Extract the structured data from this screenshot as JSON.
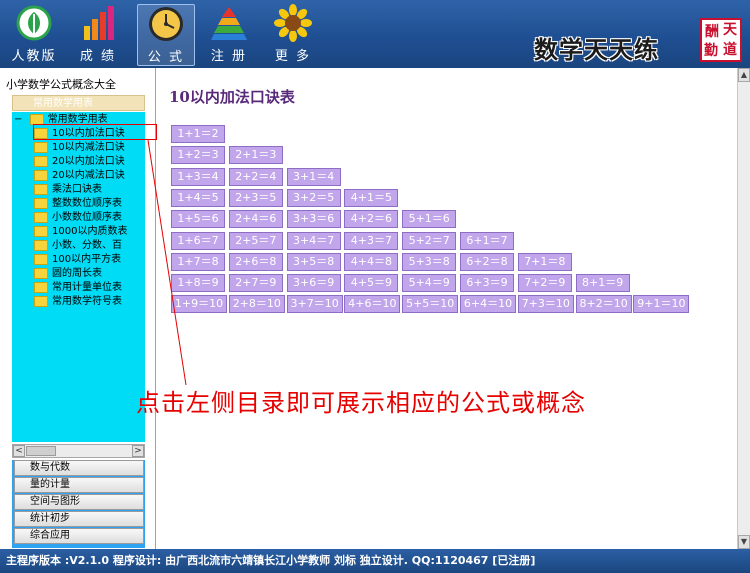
{
  "toolbar": {
    "buttons": [
      {
        "label": "人教版",
        "icon": "textbook-leaf-icon"
      },
      {
        "label": "成 绩",
        "icon": "bar-chart-icon"
      },
      {
        "label": "公 式",
        "icon": "clock-icon"
      },
      {
        "label": "注 册",
        "icon": "pyramid-icon"
      },
      {
        "label": "更 多",
        "icon": "sunflower-icon"
      }
    ],
    "logo_text": "数学天天练",
    "seal_chars": [
      "酬",
      "天",
      "勤",
      "道"
    ]
  },
  "sidebar": {
    "title": "小学数学公式概念大全",
    "active_item": "常用数学用表",
    "tree_root": "常用数学用表",
    "tree_items": [
      "10以内加法口诀",
      "10以内减法口诀",
      "20以内加法口诀",
      "20以内减法口诀",
      "乘法口诀表",
      "整数数位顺序表",
      "小数数位顺序表",
      "1000以内质数表",
      "小数、分数、百",
      "100以内平方表",
      "圆的周长表",
      "常用计量单位表",
      "常用数学符号表"
    ],
    "categories": [
      "数与代数",
      "量的计量",
      "空间与图形",
      "统计初步",
      "综合应用"
    ],
    "scroll_left": "<",
    "scroll_right": ">"
  },
  "main": {
    "title": "10以内加法口诀表",
    "table": [
      [
        "1+1＝2"
      ],
      [
        "1+2＝3",
        "2+1＝3"
      ],
      [
        "1+3＝4",
        "2+2＝4",
        "3+1＝4"
      ],
      [
        "1+4＝5",
        "2+3＝5",
        "3+2＝5",
        "4+1＝5"
      ],
      [
        "1+5＝6",
        "2+4＝6",
        "3+3＝6",
        "4+2＝6",
        "5+1＝6"
      ],
      [
        "1+6＝7",
        "2+5＝7",
        "3+4＝7",
        "4+3＝7",
        "5+2＝7",
        "6+1＝7"
      ],
      [
        "1+7＝8",
        "2+6＝8",
        "3+5＝8",
        "4+4＝8",
        "5+3＝8",
        "6+2＝8",
        "7+1＝8"
      ],
      [
        "1+8＝9",
        "2+7＝9",
        "3+6＝9",
        "4+5＝9",
        "5+4＝9",
        "6+3＝9",
        "7+2＝9",
        "8+1＝9"
      ],
      [
        "1+9＝10",
        "2+8＝10",
        "3+7＝10",
        "4+6＝10",
        "5+5＝10",
        "6+4＝10",
        "7+3＝10",
        "8+2＝10",
        "9+1＝10"
      ]
    ]
  },
  "annotation": {
    "text": "点击左侧目录即可展示相应的公式或概念"
  },
  "status_bar": {
    "text": "主程序版本 :V2.1.0   程序设计: 由广西北流市六靖镇长江小学教师 刘标 独立设计.   QQ:1120467  [已注册]"
  },
  "colors": {
    "toolbar_bg": "#1f4f93",
    "tree_bg": "#00dcf5",
    "cell_bg": "#c2a6eb",
    "annotation": "#e60000",
    "title": "#5a2a7a"
  }
}
